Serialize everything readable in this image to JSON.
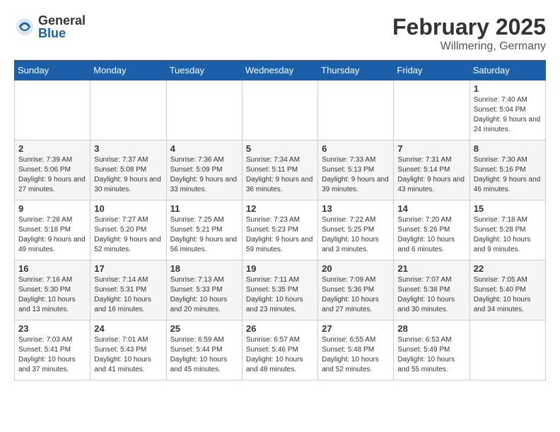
{
  "logo": {
    "general": "General",
    "blue": "Blue"
  },
  "header": {
    "month": "February 2025",
    "location": "Willmering, Germany"
  },
  "weekdays": [
    "Sunday",
    "Monday",
    "Tuesday",
    "Wednesday",
    "Thursday",
    "Friday",
    "Saturday"
  ],
  "weeks": [
    [
      {
        "day": "",
        "info": ""
      },
      {
        "day": "",
        "info": ""
      },
      {
        "day": "",
        "info": ""
      },
      {
        "day": "",
        "info": ""
      },
      {
        "day": "",
        "info": ""
      },
      {
        "day": "",
        "info": ""
      },
      {
        "day": "1",
        "info": "Sunrise: 7:40 AM\nSunset: 5:04 PM\nDaylight: 9 hours and 24 minutes."
      }
    ],
    [
      {
        "day": "2",
        "info": "Sunrise: 7:39 AM\nSunset: 5:06 PM\nDaylight: 9 hours and 27 minutes."
      },
      {
        "day": "3",
        "info": "Sunrise: 7:37 AM\nSunset: 5:08 PM\nDaylight: 9 hours and 30 minutes."
      },
      {
        "day": "4",
        "info": "Sunrise: 7:36 AM\nSunset: 5:09 PM\nDaylight: 9 hours and 33 minutes."
      },
      {
        "day": "5",
        "info": "Sunrise: 7:34 AM\nSunset: 5:11 PM\nDaylight: 9 hours and 36 minutes."
      },
      {
        "day": "6",
        "info": "Sunrise: 7:33 AM\nSunset: 5:13 PM\nDaylight: 9 hours and 39 minutes."
      },
      {
        "day": "7",
        "info": "Sunrise: 7:31 AM\nSunset: 5:14 PM\nDaylight: 9 hours and 43 minutes."
      },
      {
        "day": "8",
        "info": "Sunrise: 7:30 AM\nSunset: 5:16 PM\nDaylight: 9 hours and 46 minutes."
      }
    ],
    [
      {
        "day": "9",
        "info": "Sunrise: 7:28 AM\nSunset: 5:18 PM\nDaylight: 9 hours and 49 minutes."
      },
      {
        "day": "10",
        "info": "Sunrise: 7:27 AM\nSunset: 5:20 PM\nDaylight: 9 hours and 52 minutes."
      },
      {
        "day": "11",
        "info": "Sunrise: 7:25 AM\nSunset: 5:21 PM\nDaylight: 9 hours and 56 minutes."
      },
      {
        "day": "12",
        "info": "Sunrise: 7:23 AM\nSunset: 5:23 PM\nDaylight: 9 hours and 59 minutes."
      },
      {
        "day": "13",
        "info": "Sunrise: 7:22 AM\nSunset: 5:25 PM\nDaylight: 10 hours and 3 minutes."
      },
      {
        "day": "14",
        "info": "Sunrise: 7:20 AM\nSunset: 5:26 PM\nDaylight: 10 hours and 6 minutes."
      },
      {
        "day": "15",
        "info": "Sunrise: 7:18 AM\nSunset: 5:28 PM\nDaylight: 10 hours and 9 minutes."
      }
    ],
    [
      {
        "day": "16",
        "info": "Sunrise: 7:16 AM\nSunset: 5:30 PM\nDaylight: 10 hours and 13 minutes."
      },
      {
        "day": "17",
        "info": "Sunrise: 7:14 AM\nSunset: 5:31 PM\nDaylight: 10 hours and 16 minutes."
      },
      {
        "day": "18",
        "info": "Sunrise: 7:13 AM\nSunset: 5:33 PM\nDaylight: 10 hours and 20 minutes."
      },
      {
        "day": "19",
        "info": "Sunrise: 7:11 AM\nSunset: 5:35 PM\nDaylight: 10 hours and 23 minutes."
      },
      {
        "day": "20",
        "info": "Sunrise: 7:09 AM\nSunset: 5:36 PM\nDaylight: 10 hours and 27 minutes."
      },
      {
        "day": "21",
        "info": "Sunrise: 7:07 AM\nSunset: 5:38 PM\nDaylight: 10 hours and 30 minutes."
      },
      {
        "day": "22",
        "info": "Sunrise: 7:05 AM\nSunset: 5:40 PM\nDaylight: 10 hours and 34 minutes."
      }
    ],
    [
      {
        "day": "23",
        "info": "Sunrise: 7:03 AM\nSunset: 5:41 PM\nDaylight: 10 hours and 37 minutes."
      },
      {
        "day": "24",
        "info": "Sunrise: 7:01 AM\nSunset: 5:43 PM\nDaylight: 10 hours and 41 minutes."
      },
      {
        "day": "25",
        "info": "Sunrise: 6:59 AM\nSunset: 5:44 PM\nDaylight: 10 hours and 45 minutes."
      },
      {
        "day": "26",
        "info": "Sunrise: 6:57 AM\nSunset: 5:46 PM\nDaylight: 10 hours and 48 minutes."
      },
      {
        "day": "27",
        "info": "Sunrise: 6:55 AM\nSunset: 5:48 PM\nDaylight: 10 hours and 52 minutes."
      },
      {
        "day": "28",
        "info": "Sunrise: 6:53 AM\nSunset: 5:49 PM\nDaylight: 10 hours and 55 minutes."
      },
      {
        "day": "",
        "info": ""
      }
    ]
  ]
}
